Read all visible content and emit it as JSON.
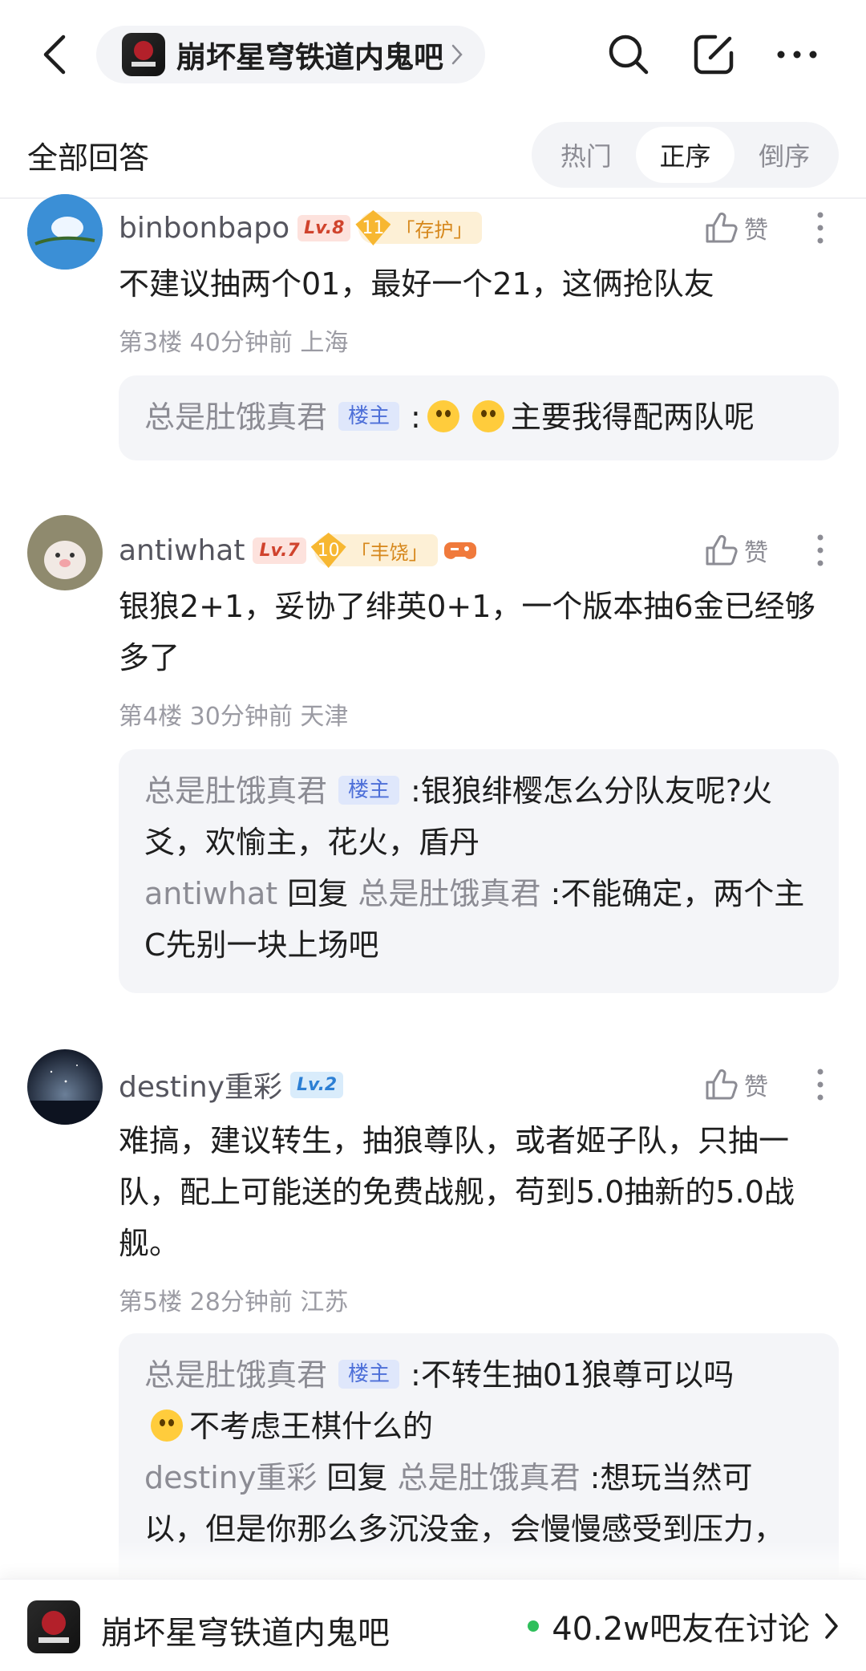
{
  "topbar": {
    "forum_name": "崩坏星穹铁道内鬼吧"
  },
  "section": {
    "title": "全部回答",
    "sort_tabs": [
      "热门",
      "正序",
      "倒序"
    ],
    "active_sort": "正序"
  },
  "like_label": "赞",
  "host_label": "楼主",
  "reply_word": "回复",
  "posts": [
    {
      "username": "binbonbapo",
      "level": "Lv.8",
      "badge_num": "11",
      "badge_text": "「存护」",
      "content": "不建议抽两个01，最好一个21，这俩抢队友",
      "floor": "第3楼",
      "time": "40分钟前",
      "location": "上海",
      "replies": [
        {
          "name": "总是肚饿真君",
          "text": "主要我得配两队呢"
        }
      ]
    },
    {
      "username": "antiwhat",
      "level": "Lv.7",
      "badge_num": "10",
      "badge_text": "「丰饶」",
      "content": "银狼2+1，妥协了绯英0+1，一个版本抽6金已经够多了",
      "floor": "第4楼",
      "time": "30分钟前",
      "location": "天津",
      "replies": [
        {
          "name": "总是肚饿真君",
          "text": "银狼绯樱怎么分队友呢?火爻，欢愉主，花火，盾丹"
        },
        {
          "name": "antiwhat",
          "target": "总是肚饿真君",
          "text": ":不能确定，两个主C先别一块上场吧"
        }
      ]
    },
    {
      "username": "destiny重彩",
      "level": "Lv.2",
      "content": "难搞，建议转生，抽狼尊队，或者姬子队，只抽一队，配上可能送的免费战舰，苟到5.0抽新的5.0战舰。",
      "floor": "第5楼",
      "time": "28分钟前",
      "location": "江苏",
      "replies": [
        {
          "name": "总是肚饿真君",
          "text": "不转生抽01狼尊可以吗",
          "text2": "不考虑王棋什么的"
        },
        {
          "name": "destiny重彩",
          "target": "总是肚饿真君",
          "text": ":想玩当然可以，但是你那么多沉没金，会慢慢感受到压力，"
        }
      ]
    }
  ],
  "bottombar": {
    "forum_name": "崩坏星穹铁道内鬼吧",
    "discussion": "40.2w吧友在讨论"
  },
  "colors": {
    "accent_blue": "#4d6fd8",
    "level_red": "#d0432d",
    "badge_gold": "#f7b731",
    "online_green": "#2fbf5b"
  }
}
